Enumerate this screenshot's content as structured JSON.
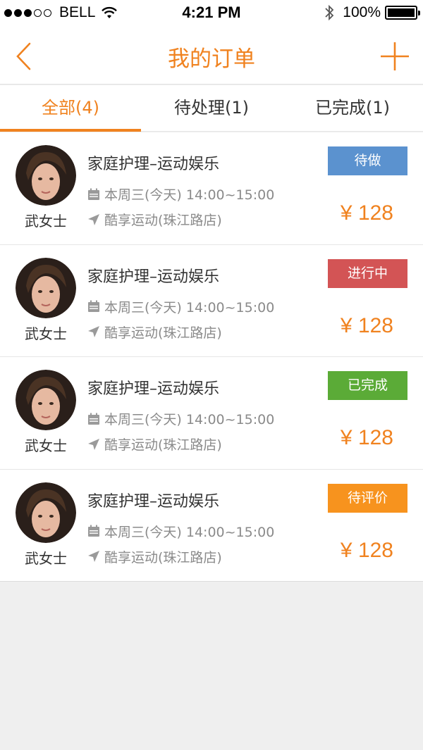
{
  "status_bar": {
    "carrier": "BELL",
    "time": "4:21 PM",
    "battery": "100%",
    "signal_bars_filled": 3,
    "signal_bars_total": 5
  },
  "nav": {
    "title": "我的订单",
    "back_icon": "chevron-left-icon",
    "add_icon": "plus-icon"
  },
  "tabs": [
    {
      "label": "全部(4)",
      "active": true
    },
    {
      "label": "待处理(1)",
      "active": false
    },
    {
      "label": "已完成(1)",
      "active": false
    }
  ],
  "colors": {
    "accent": "#f0821f",
    "status_todo": "#5b92cf",
    "status_in_progress": "#d35455",
    "status_done": "#5bab37",
    "status_review": "#f7931e"
  },
  "orders": [
    {
      "customer": "武女士",
      "service": "家庭护理–运动娱乐",
      "time": "本周三(今天) 14:00~15:00",
      "place": "酷享运动(珠江路店)",
      "status": "待做",
      "status_color": "#5b92cf",
      "price": "¥ 128"
    },
    {
      "customer": "武女士",
      "service": "家庭护理–运动娱乐",
      "time": "本周三(今天) 14:00~15:00",
      "place": "酷享运动(珠江路店)",
      "status": "进行中",
      "status_color": "#d35455",
      "price": "¥ 128"
    },
    {
      "customer": "武女士",
      "service": "家庭护理–运动娱乐",
      "time": "本周三(今天) 14:00~15:00",
      "place": "酷享运动(珠江路店)",
      "status": "已完成",
      "status_color": "#5bab37",
      "price": "¥ 128"
    },
    {
      "customer": "武女士",
      "service": "家庭护理–运动娱乐",
      "time": "本周三(今天) 14:00~15:00",
      "place": "酷享运动(珠江路店)",
      "status": "待评价",
      "status_color": "#f7931e",
      "price": "¥ 128"
    }
  ]
}
